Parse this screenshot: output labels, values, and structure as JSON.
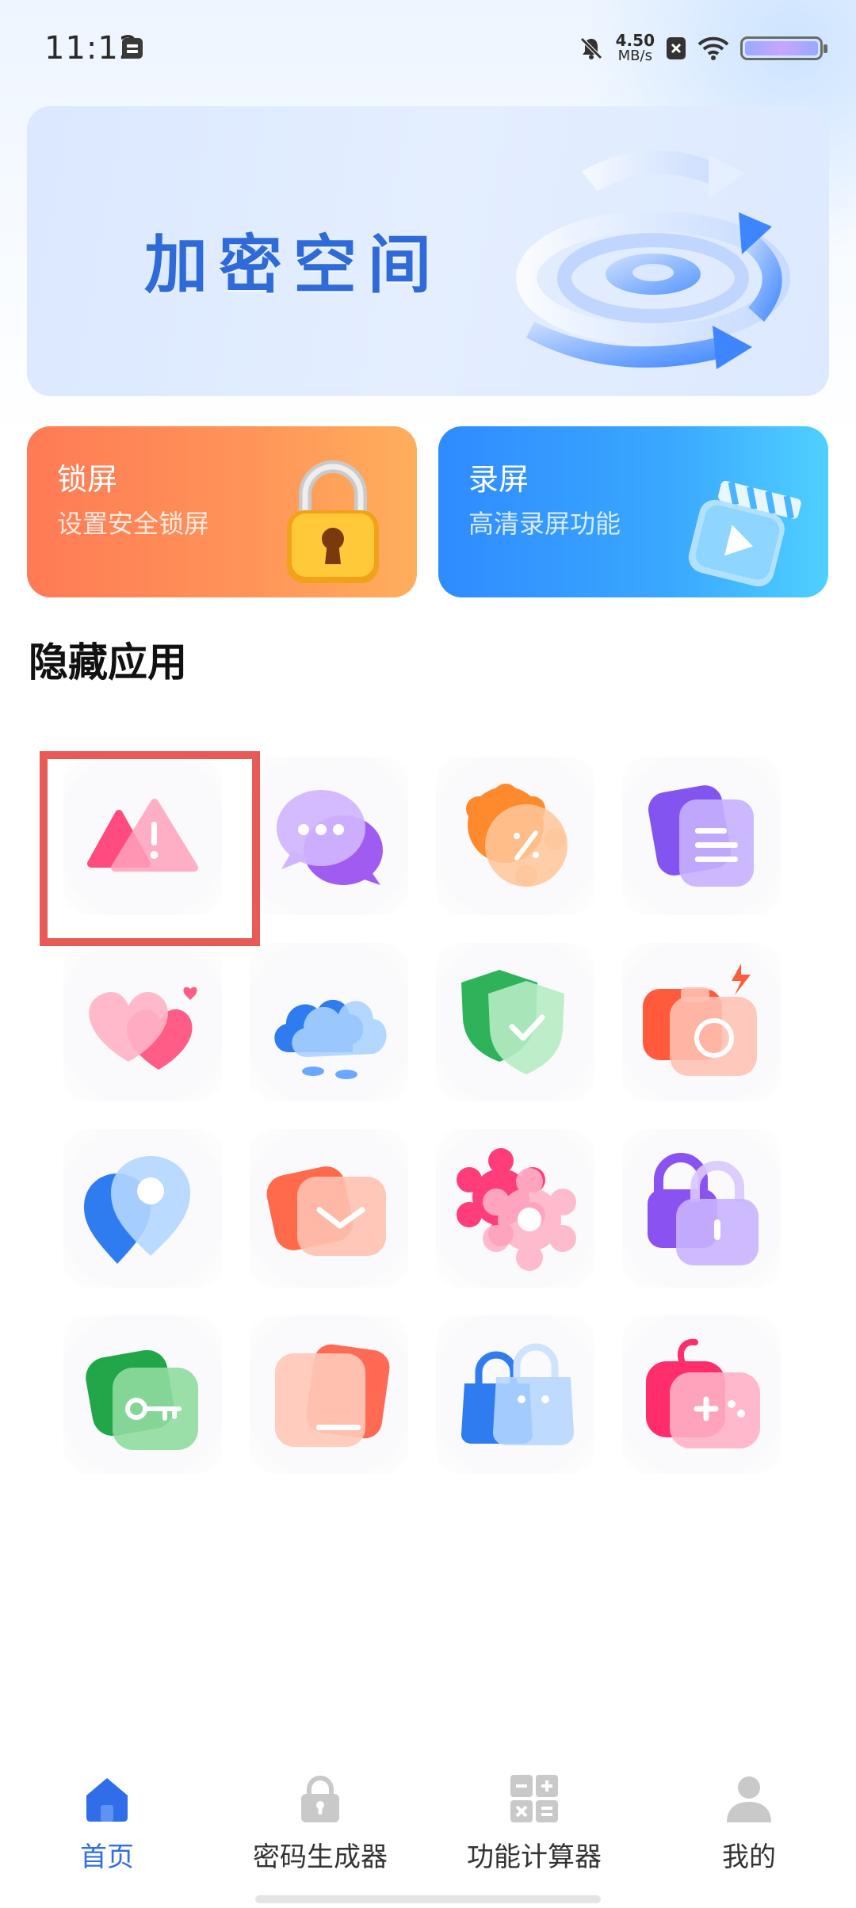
{
  "status_bar": {
    "time": "11:12",
    "net_speed_value": "4.50",
    "net_speed_unit": "MB/s"
  },
  "banner": {
    "title": "加密空间"
  },
  "cards": {
    "lock": {
      "title": "锁屏",
      "subtitle": "设置安全锁屏"
    },
    "record": {
      "title": "录屏",
      "subtitle": "高清录屏功能"
    }
  },
  "section": {
    "title": "隐藏应用"
  },
  "apps": [
    {
      "icon": "warning-triangle-icon"
    },
    {
      "icon": "chat-bubble-icon"
    },
    {
      "icon": "discount-badge-icon"
    },
    {
      "icon": "notes-icon"
    },
    {
      "icon": "heart-icon"
    },
    {
      "icon": "cloud-icon"
    },
    {
      "icon": "shield-check-icon"
    },
    {
      "icon": "camera-icon"
    },
    {
      "icon": "location-pin-icon"
    },
    {
      "icon": "mail-icon"
    },
    {
      "icon": "settings-gear-icon"
    },
    {
      "icon": "padlock-icon"
    },
    {
      "icon": "key-icon"
    },
    {
      "icon": "folder-icon"
    },
    {
      "icon": "shopping-bag-icon"
    },
    {
      "icon": "gamepad-icon"
    }
  ],
  "nav": [
    {
      "label": "首页",
      "icon": "home-icon",
      "active": true
    },
    {
      "label": "密码生成器",
      "icon": "lock-icon",
      "active": false
    },
    {
      "label": "功能计算器",
      "icon": "calculator-icon",
      "active": false
    },
    {
      "label": "我的",
      "icon": "profile-icon",
      "active": false
    }
  ],
  "colors": {
    "accent": "#2f6ee8",
    "lock_card": "#ff8557",
    "record_card": "#3aa8ff",
    "selection": "#e85a55"
  }
}
